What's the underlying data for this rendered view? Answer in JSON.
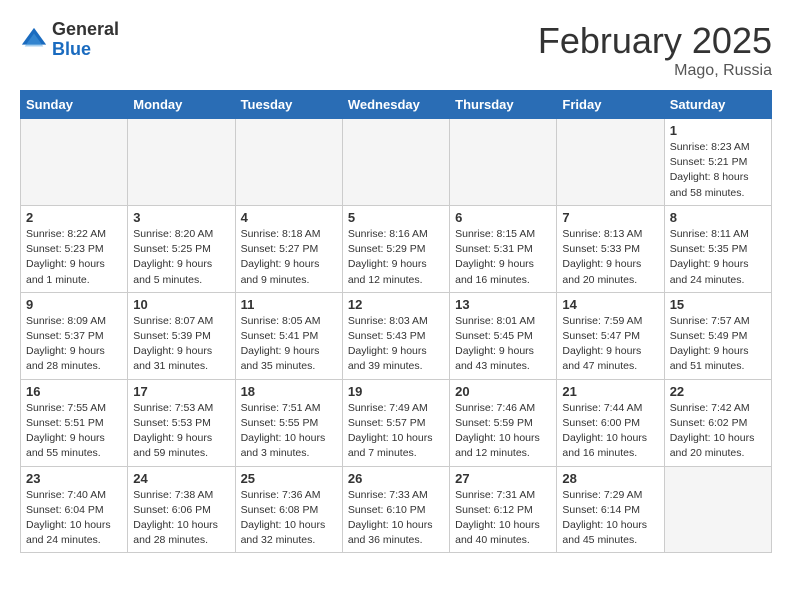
{
  "header": {
    "logo_general": "General",
    "logo_blue": "Blue",
    "month_title": "February 2025",
    "location": "Mago, Russia"
  },
  "weekdays": [
    "Sunday",
    "Monday",
    "Tuesday",
    "Wednesday",
    "Thursday",
    "Friday",
    "Saturday"
  ],
  "weeks": [
    [
      {
        "day": "",
        "info": ""
      },
      {
        "day": "",
        "info": ""
      },
      {
        "day": "",
        "info": ""
      },
      {
        "day": "",
        "info": ""
      },
      {
        "day": "",
        "info": ""
      },
      {
        "day": "",
        "info": ""
      },
      {
        "day": "1",
        "info": "Sunrise: 8:23 AM\nSunset: 5:21 PM\nDaylight: 8 hours and 58 minutes."
      }
    ],
    [
      {
        "day": "2",
        "info": "Sunrise: 8:22 AM\nSunset: 5:23 PM\nDaylight: 9 hours and 1 minute."
      },
      {
        "day": "3",
        "info": "Sunrise: 8:20 AM\nSunset: 5:25 PM\nDaylight: 9 hours and 5 minutes."
      },
      {
        "day": "4",
        "info": "Sunrise: 8:18 AM\nSunset: 5:27 PM\nDaylight: 9 hours and 9 minutes."
      },
      {
        "day": "5",
        "info": "Sunrise: 8:16 AM\nSunset: 5:29 PM\nDaylight: 9 hours and 12 minutes."
      },
      {
        "day": "6",
        "info": "Sunrise: 8:15 AM\nSunset: 5:31 PM\nDaylight: 9 hours and 16 minutes."
      },
      {
        "day": "7",
        "info": "Sunrise: 8:13 AM\nSunset: 5:33 PM\nDaylight: 9 hours and 20 minutes."
      },
      {
        "day": "8",
        "info": "Sunrise: 8:11 AM\nSunset: 5:35 PM\nDaylight: 9 hours and 24 minutes."
      }
    ],
    [
      {
        "day": "9",
        "info": "Sunrise: 8:09 AM\nSunset: 5:37 PM\nDaylight: 9 hours and 28 minutes."
      },
      {
        "day": "10",
        "info": "Sunrise: 8:07 AM\nSunset: 5:39 PM\nDaylight: 9 hours and 31 minutes."
      },
      {
        "day": "11",
        "info": "Sunrise: 8:05 AM\nSunset: 5:41 PM\nDaylight: 9 hours and 35 minutes."
      },
      {
        "day": "12",
        "info": "Sunrise: 8:03 AM\nSunset: 5:43 PM\nDaylight: 9 hours and 39 minutes."
      },
      {
        "day": "13",
        "info": "Sunrise: 8:01 AM\nSunset: 5:45 PM\nDaylight: 9 hours and 43 minutes."
      },
      {
        "day": "14",
        "info": "Sunrise: 7:59 AM\nSunset: 5:47 PM\nDaylight: 9 hours and 47 minutes."
      },
      {
        "day": "15",
        "info": "Sunrise: 7:57 AM\nSunset: 5:49 PM\nDaylight: 9 hours and 51 minutes."
      }
    ],
    [
      {
        "day": "16",
        "info": "Sunrise: 7:55 AM\nSunset: 5:51 PM\nDaylight: 9 hours and 55 minutes."
      },
      {
        "day": "17",
        "info": "Sunrise: 7:53 AM\nSunset: 5:53 PM\nDaylight: 9 hours and 59 minutes."
      },
      {
        "day": "18",
        "info": "Sunrise: 7:51 AM\nSunset: 5:55 PM\nDaylight: 10 hours and 3 minutes."
      },
      {
        "day": "19",
        "info": "Sunrise: 7:49 AM\nSunset: 5:57 PM\nDaylight: 10 hours and 7 minutes."
      },
      {
        "day": "20",
        "info": "Sunrise: 7:46 AM\nSunset: 5:59 PM\nDaylight: 10 hours and 12 minutes."
      },
      {
        "day": "21",
        "info": "Sunrise: 7:44 AM\nSunset: 6:00 PM\nDaylight: 10 hours and 16 minutes."
      },
      {
        "day": "22",
        "info": "Sunrise: 7:42 AM\nSunset: 6:02 PM\nDaylight: 10 hours and 20 minutes."
      }
    ],
    [
      {
        "day": "23",
        "info": "Sunrise: 7:40 AM\nSunset: 6:04 PM\nDaylight: 10 hours and 24 minutes."
      },
      {
        "day": "24",
        "info": "Sunrise: 7:38 AM\nSunset: 6:06 PM\nDaylight: 10 hours and 28 minutes."
      },
      {
        "day": "25",
        "info": "Sunrise: 7:36 AM\nSunset: 6:08 PM\nDaylight: 10 hours and 32 minutes."
      },
      {
        "day": "26",
        "info": "Sunrise: 7:33 AM\nSunset: 6:10 PM\nDaylight: 10 hours and 36 minutes."
      },
      {
        "day": "27",
        "info": "Sunrise: 7:31 AM\nSunset: 6:12 PM\nDaylight: 10 hours and 40 minutes."
      },
      {
        "day": "28",
        "info": "Sunrise: 7:29 AM\nSunset: 6:14 PM\nDaylight: 10 hours and 45 minutes."
      },
      {
        "day": "",
        "info": ""
      }
    ]
  ]
}
